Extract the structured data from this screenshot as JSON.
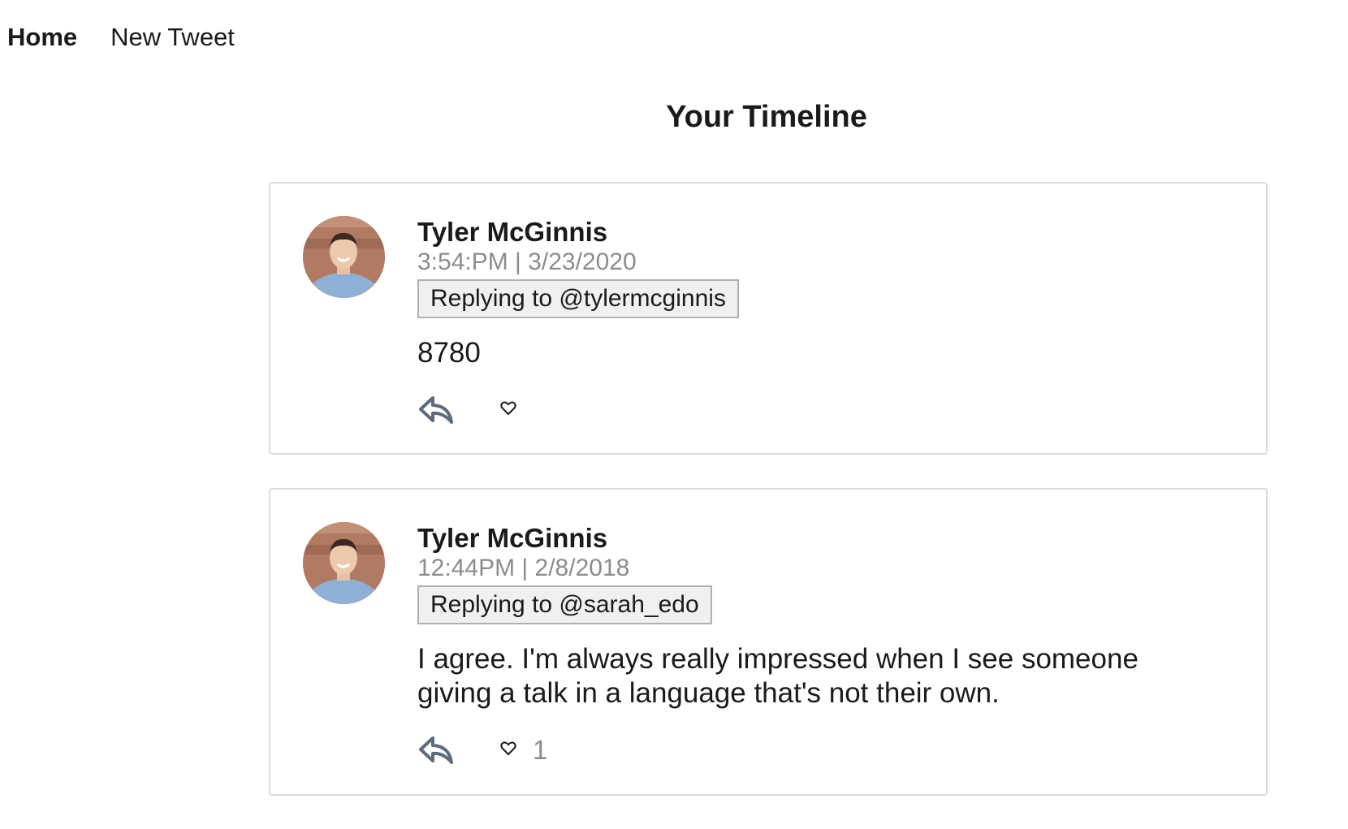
{
  "nav": {
    "home_label": "Home",
    "new_tweet_label": "New Tweet"
  },
  "page": {
    "title": "Your Timeline"
  },
  "tweets": [
    {
      "author": "Tyler McGinnis",
      "date": "3:54:PM | 3/23/2020",
      "replying_to": "Replying to @tylermcginnis",
      "text": "8780",
      "likes": ""
    },
    {
      "author": "Tyler McGinnis",
      "date": "12:44PM | 2/8/2018",
      "replying_to": "Replying to @sarah_edo",
      "text": "I agree. I'm always really impressed when I see someone giving a talk in a language that's not their own.",
      "likes": "1"
    }
  ],
  "icons": {
    "reply": "reply-icon",
    "like": "heart-outline-icon",
    "icon_color": "#5f6b7a"
  }
}
